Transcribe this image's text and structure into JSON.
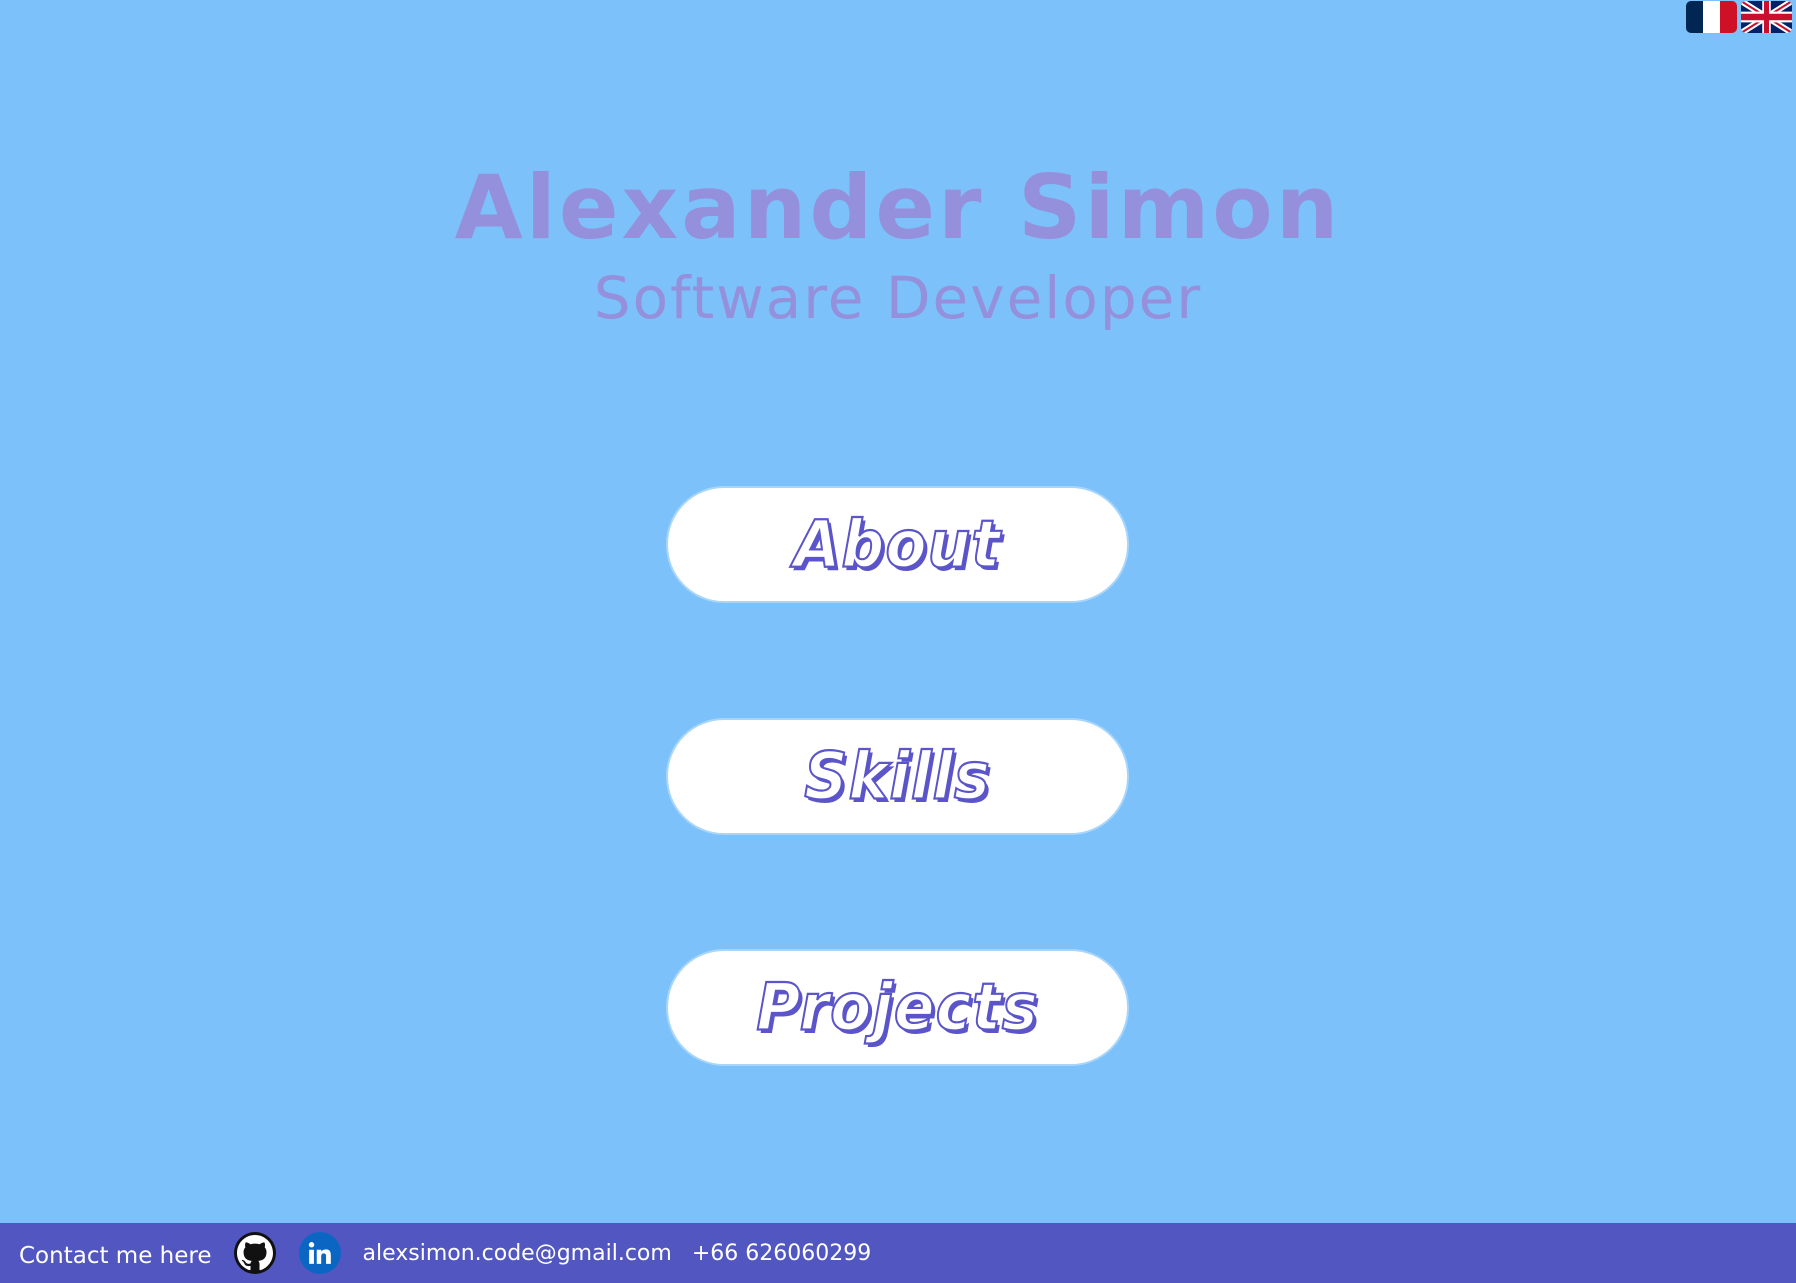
{
  "language_switcher": {
    "options": [
      {
        "icon": "france-flag-icon",
        "code": "fr"
      },
      {
        "icon": "uk-flag-icon",
        "code": "en"
      }
    ]
  },
  "header": {
    "name": "Alexander Simon",
    "role": "Software Developer"
  },
  "nav": {
    "about": "About",
    "skills": "Skills",
    "projects": "Projects"
  },
  "footer": {
    "contact_label": "Contact me here",
    "github_icon": "github-icon",
    "linkedin_icon": "linkedin-icon",
    "email": "alexsimon.code@gmail.com",
    "phone": "+66 626060299"
  },
  "colors": {
    "background": "#7cc1fa",
    "title": "#9590dc",
    "button_text_outline": "#5b55c9",
    "footer": "#5156c0",
    "linkedin": "#0a66c2"
  }
}
